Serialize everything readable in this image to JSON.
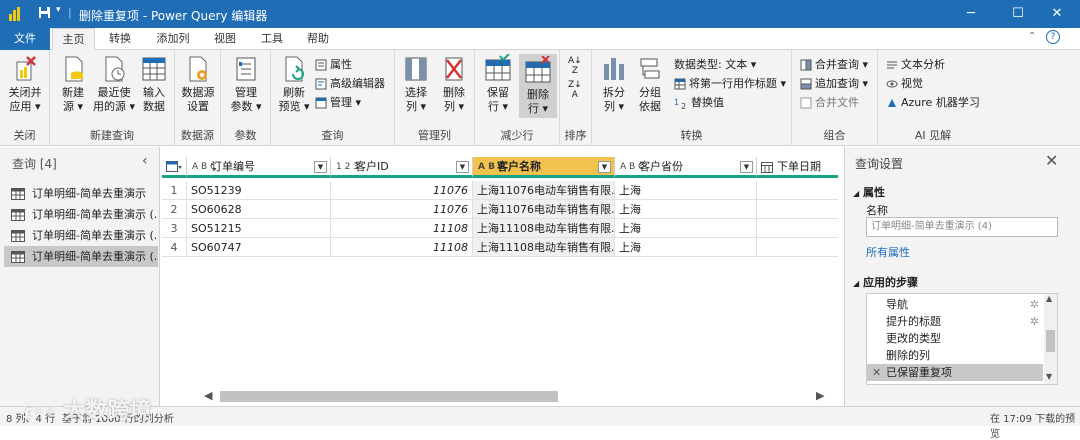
{
  "window": {
    "title": "删除重复项 - Power Query 编辑器",
    "controls": {
      "minimize": "─",
      "maximize": "☐",
      "close": "✕"
    }
  },
  "menu": {
    "tabs": [
      "文件",
      "主页",
      "转换",
      "添加列",
      "视图",
      "工具",
      "帮助"
    ],
    "active": "主页"
  },
  "ribbon": {
    "groups": {
      "close": {
        "label": "关闭",
        "btn1": "关闭并",
        "btn2": "应用 ▾"
      },
      "new_query": {
        "label": "新建查询",
        "new_source": [
          "新建",
          "源 ▾"
        ],
        "recent": [
          "最近使",
          "用的源 ▾"
        ],
        "enter": [
          "输入",
          "数据"
        ]
      },
      "data_source": {
        "label": "数据源",
        "settings": [
          "数据源",
          "设置"
        ]
      },
      "params": {
        "label": "参数",
        "manage": [
          "管理",
          "参数 ▾"
        ]
      },
      "query": {
        "label": "查询",
        "refresh": [
          "刷新",
          "预览 ▾"
        ],
        "properties": "属性",
        "advanced": "高级编辑器",
        "manage": "管理 ▾"
      },
      "manage_cols": {
        "label": "管理列",
        "choose": [
          "选择",
          "列 ▾"
        ],
        "remove": [
          "删除",
          "列 ▾"
        ]
      },
      "reduce_rows": {
        "label": "减少行",
        "keep": [
          "保留",
          "行 ▾"
        ],
        "remove": [
          "删除",
          "行 ▾"
        ]
      },
      "sort": {
        "label": "排序"
      },
      "transform": {
        "label": "转换",
        "split": [
          "拆分",
          "列 ▾"
        ],
        "group": [
          "分组",
          "依据"
        ],
        "datatype": "数据类型: 文本 ▾",
        "first_row": "将第一行用作标题 ▾",
        "replace": "替换值"
      },
      "combine": {
        "label": "组合",
        "merge": "合并查询 ▾",
        "append": "追加查询 ▾",
        "merge_files": "合并文件"
      },
      "ai": {
        "label": "AI 见解",
        "text": "文本分析",
        "vision": "视觉",
        "azure": "Azure 机器学习"
      }
    }
  },
  "queries": {
    "header": "查询 [4]",
    "items": [
      "订单明细-简单去重演示",
      "订单明细-简单去重演示 (...",
      "订单明细-简单去重演示 (...",
      "订单明细-简单去重演示 (..."
    ],
    "selected_index": 3
  },
  "table": {
    "columns": [
      {
        "type": "A B C",
        "name": "订单编号"
      },
      {
        "type": "1 2 3",
        "name": "客户ID"
      },
      {
        "type": "A B C",
        "name": "客户名称"
      },
      {
        "type": "A B C",
        "name": "客户省份"
      },
      {
        "type": "",
        "name": "下单日期"
      }
    ],
    "rows": [
      {
        "n": "1",
        "order": "SO51239",
        "cid": "11076",
        "name": "上海11076电动车销售有限...",
        "prov": "上海"
      },
      {
        "n": "2",
        "order": "SO60628",
        "cid": "11076",
        "name": "上海11076电动车销售有限...",
        "prov": "上海"
      },
      {
        "n": "3",
        "order": "SO51215",
        "cid": "11108",
        "name": "上海11108电动车销售有限...",
        "prov": "上海"
      },
      {
        "n": "4",
        "order": "SO60747",
        "cid": "11108",
        "name": "上海11108电动车销售有限...",
        "prov": "上海"
      }
    ]
  },
  "settings": {
    "title": "查询设置",
    "properties_header": "属性",
    "name_label": "名称",
    "name_value": "订单明细-简单去重演示 (4)",
    "all_props": "所有属性",
    "steps_header": "应用的步骤",
    "steps": [
      "导航",
      "提升的标题",
      "更改的类型",
      "删除的列",
      "已保留重复项"
    ]
  },
  "status": {
    "left": "8 列、4 行",
    "middle": "基于前 1000 行的列分析",
    "right": "在 17:09 下载的预览"
  },
  "watermark": "大数跨境",
  "colors": {
    "accent": "#1e6db5",
    "selected_col": "#f2c24f",
    "quality_bar": "#17a384"
  }
}
